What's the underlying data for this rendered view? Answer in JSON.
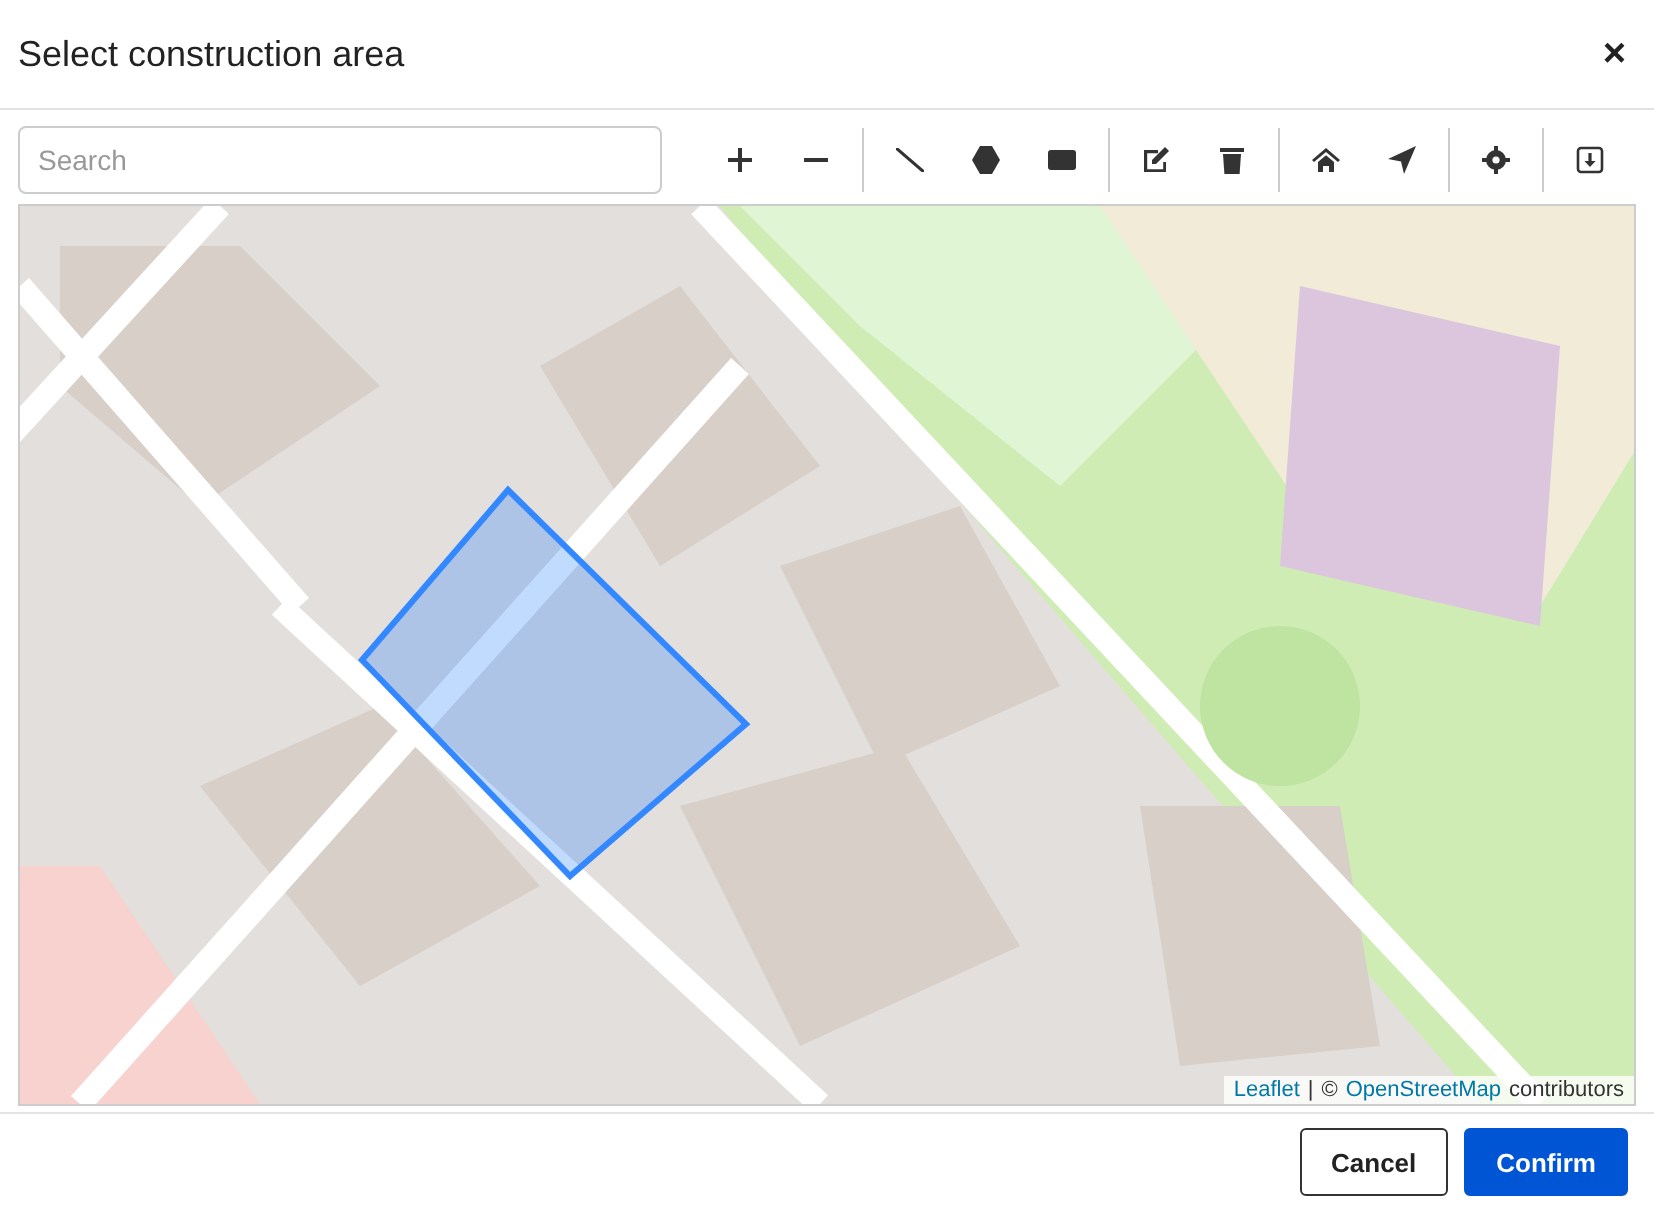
{
  "dialog": {
    "title": "Select construction area",
    "close": "×"
  },
  "search": {
    "placeholder": "Search"
  },
  "toolbar": [
    {
      "tools": [
        {
          "kind": "zoom-in"
        },
        {
          "kind": "zoom-out"
        }
      ]
    },
    {
      "tools": [
        {
          "kind": "line"
        },
        {
          "kind": "polygon"
        },
        {
          "kind": "rectangle"
        }
      ]
    },
    {
      "tools": [
        {
          "kind": "edit"
        },
        {
          "kind": "delete"
        }
      ]
    },
    {
      "tools": [
        {
          "kind": "home"
        },
        {
          "kind": "locate"
        }
      ]
    },
    {
      "tools": [
        {
          "kind": "settings"
        }
      ]
    },
    {
      "tools": [
        {
          "kind": "download"
        }
      ]
    }
  ],
  "map": {
    "kind": "picture",
    "drawn_area": true,
    "attribution": {
      "link": "Leaflet",
      "separator": "|",
      "copyright": "©",
      "osm_link": "OpenStreetMap",
      "suffix": "contributors"
    }
  },
  "buttons": [
    {
      "label": "Cancel",
      "kind": "secondary"
    },
    {
      "label": "Confirm",
      "kind": "primary"
    }
  ]
}
